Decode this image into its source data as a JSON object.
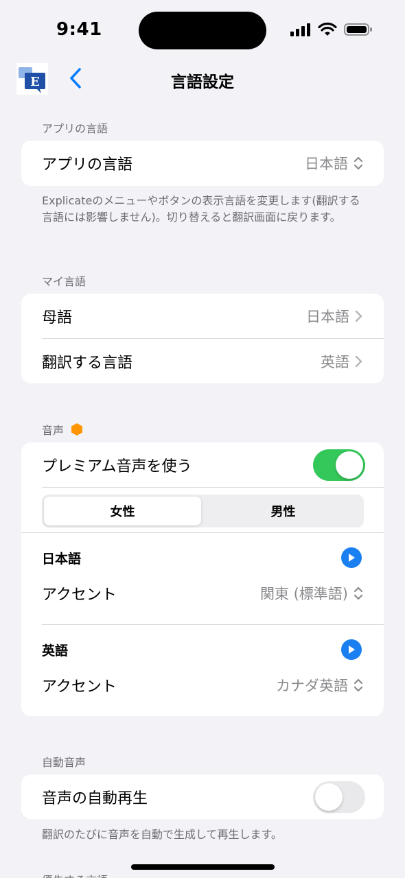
{
  "status_bar": {
    "time": "9:41"
  },
  "nav": {
    "title": "言語設定",
    "logo_letter": "E"
  },
  "app_language": {
    "header": "アプリの言語",
    "row_label": "アプリの言語",
    "row_value": "日本語",
    "footnote": "Explicateのメニューやボタンの表示言語を変更します(翻訳する言語には影響しません)。切り替えると翻訳画面に戻ります。"
  },
  "my_languages": {
    "header": "マイ言語",
    "native_label": "母語",
    "native_value": "日本語",
    "target_label": "翻訳する言語",
    "target_value": "英語"
  },
  "voice": {
    "header": "音声",
    "premium_badge_color": "#ff9500",
    "premium_label": "プレミアム音声を使う",
    "premium_enabled": true,
    "gender_options": [
      "女性",
      "男性"
    ],
    "gender_selected": "女性",
    "languages": [
      {
        "name": "日本語",
        "accent_label": "アクセント",
        "accent_value": "関東 (標準語)"
      },
      {
        "name": "英語",
        "accent_label": "アクセント",
        "accent_value": "カナダ英語"
      }
    ]
  },
  "auto_voice": {
    "header": "自動音声",
    "label": "音声の自動再生",
    "enabled": false,
    "footnote": "翻訳のたびに音声を自動で生成して再生します。"
  },
  "next_section": {
    "header": "優先する言語"
  },
  "colors": {
    "accent": "#007aff",
    "toggle_on": "#34c759",
    "play": "#1a7ff0"
  }
}
